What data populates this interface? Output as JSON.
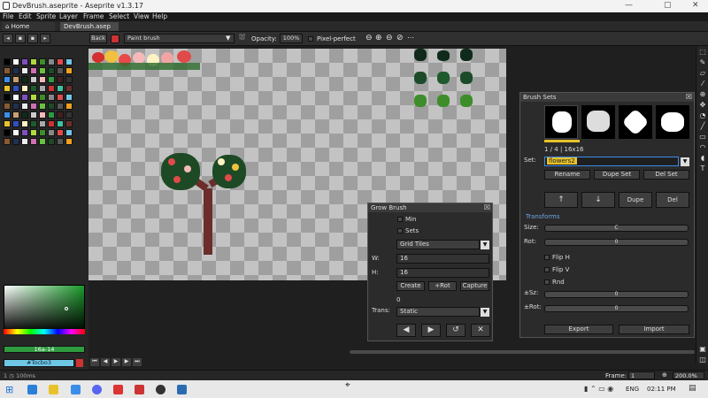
{
  "window": {
    "title": "DevBrush.aseprite - Aseprite v1.3.17"
  },
  "menu": [
    "File",
    "Edit",
    "Sprite",
    "Layer",
    "Frame",
    "Select",
    "View",
    "Help"
  ],
  "tabs": [
    {
      "label": "Home"
    },
    {
      "label": "DevBrush.asep"
    }
  ],
  "toolbar": {
    "back_label": "Back",
    "tool_value": "Paint brush",
    "opacity_label": "Opacity:",
    "opacity_value": "100%",
    "pixel_perfect_label": "Pixel-perfect"
  },
  "left": {
    "color_hex": "16a-14",
    "tag_label": "#Tocbo3"
  },
  "grow_brush": {
    "title": "Grow Brush",
    "min_label": "Min",
    "sets_label": "Sets",
    "mode_value": "Grid Tiles",
    "w_label": "W:",
    "w_value": "16",
    "h_label": "H:",
    "h_value": "16",
    "create_label": "Create",
    "rot_label": "+Rot",
    "capture_label": "Capture",
    "count": "0",
    "trans_label": "Trans:",
    "trans_value": "Static"
  },
  "brush_sets": {
    "title": "Brush Sets",
    "info": "1 / 4   |   16x16",
    "set_label": "Set:",
    "set_value": "flowers2",
    "rename_label": "Rename",
    "dupe_set_label": "Dupe Set",
    "del_set_label": "Del Set",
    "up_label": "↑",
    "down_label": "↓",
    "dupe_label": "Dupe",
    "del_label": "Del",
    "transforms_label": "Transforms",
    "size_label": "Size:",
    "size_value": "C",
    "rot_label": "Rot:",
    "rot_value": "0",
    "flip_h_label": "Flip H",
    "flip_v_label": "Flip V",
    "rnd_label": "Rnd",
    "psz_label": "±Sz:",
    "psz_value": "0",
    "prot_label": "±Rot:",
    "prot_value": "0",
    "export_label": "Export",
    "import_label": "Import"
  },
  "status": {
    "frame_info": "1 ◷ 100ms",
    "frame_label": "Frame:",
    "frame_value": "1",
    "zoom_value": "200.0%"
  },
  "taskbar": {
    "lang": "ENG",
    "time": "02:11 PM"
  },
  "colors": {
    "accent_yellow": "#e8c22a",
    "selection_blue": "#3a8ee8",
    "hex_green": "#2f9a40",
    "tag_cyan": "#6fc7e6"
  }
}
